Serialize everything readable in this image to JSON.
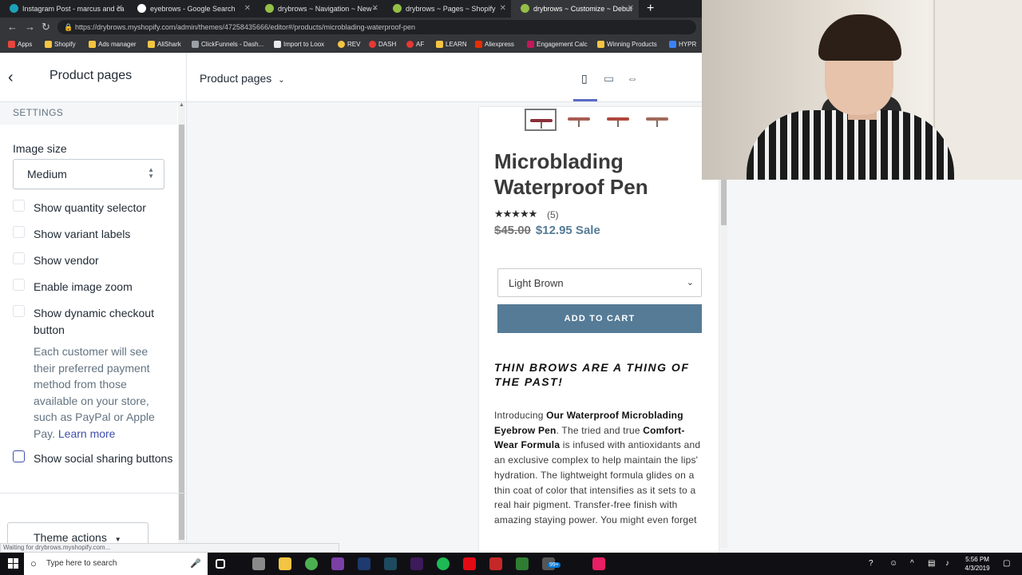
{
  "browser": {
    "tabs": [
      {
        "title": "Instagram Post - marcus and ca",
        "favicon_color": "#1da1b8"
      },
      {
        "title": "eyebrows - Google Search",
        "favicon_color": "#ffffff"
      },
      {
        "title": "drybrows ~ Navigation ~ New -",
        "favicon_color": "#95bf47"
      },
      {
        "title": "drybrows ~ Pages ~ Shopify",
        "favicon_color": "#95bf47"
      },
      {
        "title": "drybrows ~ Customize ~ Debut",
        "favicon_color": "#95bf47"
      }
    ],
    "new_tab": "+",
    "url": "https://drybrows.myshopify.com/admin/themes/47258435666/editor#/products/microblading-waterproof-pen",
    "bookmarks": [
      "Apps",
      "Shopify",
      "Ads manager",
      "AliShark",
      "ClickFunnels - Dash...",
      "Import to Loox",
      "REV",
      "DASH",
      "AF",
      "LEARN",
      "Aliexpress",
      "Engagement Calc",
      "Winning Products",
      "HYPR"
    ]
  },
  "sidebar": {
    "title": "Product pages",
    "section": "SETTINGS",
    "image_size_label": "Image size",
    "image_size_value": "Medium",
    "options": [
      {
        "label": "Show quantity selector",
        "checked": false
      },
      {
        "label": "Show variant labels",
        "checked": false
      },
      {
        "label": "Show vendor",
        "checked": false
      },
      {
        "label": "Enable image zoom",
        "checked": false
      },
      {
        "label": "Show dynamic checkout button",
        "checked": false
      },
      {
        "label": "Show social sharing buttons",
        "checked": false
      }
    ],
    "help_text": "Each customer will see their preferred payment method from those available on your store, such as PayPal or Apple Pay.",
    "learn_more": "Learn more",
    "theme_actions": "Theme actions"
  },
  "topbar": {
    "page_select": "Product pages"
  },
  "product": {
    "title": "Microblading Waterproof Pen",
    "stars": "★★★★★",
    "review_count": "(5)",
    "price_old": "$45.00",
    "price_new": "$12.95 Sale",
    "variant": "Light Brown",
    "add_to_cart": "ADD TO CART",
    "headline": "THIN BROWS ARE A THING OF THE PAST!",
    "desc_intro": "Introducing ",
    "desc_b1": "Our Waterproof Microblading Eyebrow Pen",
    "desc_mid": ". The tried and true ",
    "desc_b2": "Comfort-Wear Formula",
    "desc_rest": " is infused with antioxidants and an exclusive complex to help maintain the lips' hydration. The lightweight formula glides on a thin coat of color that intensifies as it sets to a real hair pigment. Transfer-free finish with amazing staying power. You might even forget"
  },
  "status_text": "Waiting for drybrows.myshopify.com...",
  "taskbar": {
    "search_placeholder": "Type here to search",
    "time": "5:56 PM",
    "date": "4/3/2019",
    "badge": "99+"
  },
  "colors": {
    "accent": "#5c6ac4",
    "button": "#557b97",
    "link": "#3f4eae"
  }
}
